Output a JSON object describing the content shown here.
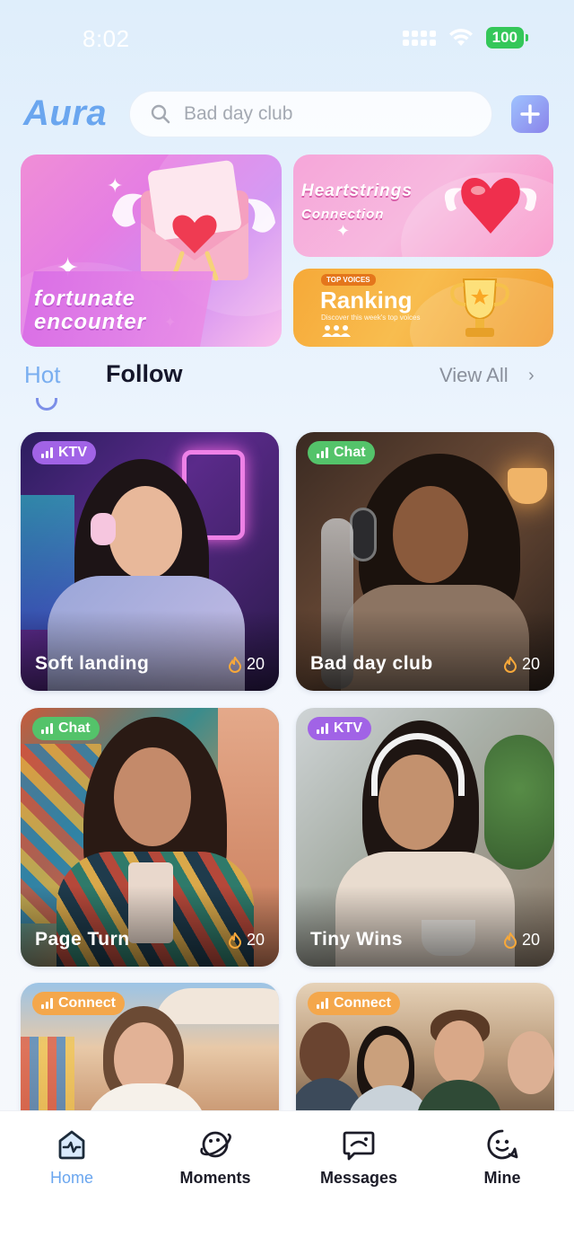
{
  "status_bar": {
    "time": "8:02",
    "battery": "100"
  },
  "header": {
    "logo": "Aura",
    "search_placeholder": "Bad day club"
  },
  "banners": {
    "big": {
      "title_line1": "fortunate",
      "title_line2": "encounter"
    },
    "top": {
      "title_line1": "Heartstrings",
      "title_line2": "Connection"
    },
    "bottom": {
      "tag": "TOP VOICES",
      "title": "Ranking",
      "subtitle": "Discover this week's top voices"
    }
  },
  "tabs": {
    "hot": "Hot",
    "follow": "Follow",
    "view_all": "View All"
  },
  "rooms": [
    {
      "type": "KTV",
      "name": "Soft landing",
      "heat": "20"
    },
    {
      "type": "Chat",
      "name": "Bad day club",
      "heat": "20"
    },
    {
      "type": "Chat",
      "name": "Page Turn",
      "heat": "20"
    },
    {
      "type": "KTV",
      "name": "Tiny Wins",
      "heat": "20"
    },
    {
      "type": "Connect",
      "name": "",
      "heat": ""
    },
    {
      "type": "Connect",
      "name": "",
      "heat": ""
    }
  ],
  "tabbar": [
    {
      "label": "Home",
      "icon": "home-icon"
    },
    {
      "label": "Moments",
      "icon": "moments-icon"
    },
    {
      "label": "Messages",
      "icon": "messages-icon"
    },
    {
      "label": "Mine",
      "icon": "mine-icon"
    }
  ],
  "colors": {
    "accent": "#6aa6ef",
    "ktv": "#a163e6",
    "chat": "#54c36a",
    "connect": "#f4a74b"
  }
}
